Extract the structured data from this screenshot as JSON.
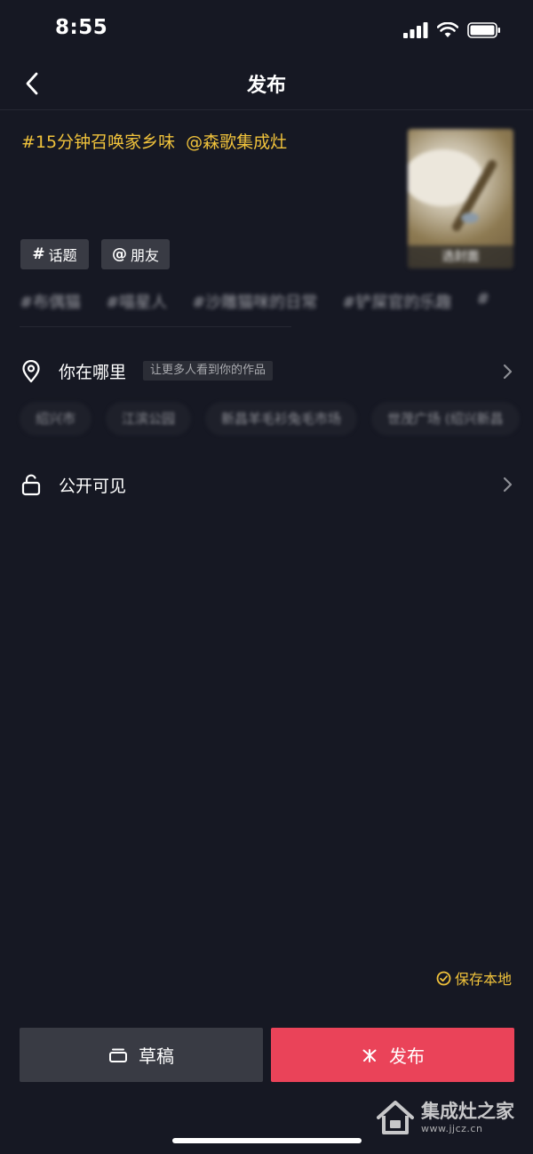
{
  "status_bar": {
    "time": "8:55"
  },
  "header": {
    "title": "发布"
  },
  "caption": {
    "hashtag": "#15分钟召唤家乡味",
    "mention": "@森歌集成灶"
  },
  "cover": {
    "label": "选封面"
  },
  "tag_buttons": {
    "topic": {
      "symbol": "#",
      "label": "话题"
    },
    "friend": {
      "symbol": "@",
      "label": "朋友"
    }
  },
  "suggested_hashtags": [
    "#布偶猫",
    "#喵星人",
    "#沙雕猫咪的日常",
    "#铲屎官的乐趣",
    "#"
  ],
  "location": {
    "label": "你在哪里",
    "hint": "让更多人看到你的作品",
    "suggestions": [
      "绍兴市",
      "江滨公园",
      "新昌羊毛衫兔毛市场",
      "世茂广场 (绍兴新昌"
    ]
  },
  "visibility": {
    "label": "公开可见"
  },
  "save_local": {
    "label": "保存本地"
  },
  "actions": {
    "draft_label": "草稿",
    "publish_label": "发布"
  },
  "watermark": {
    "title": "集成灶之家",
    "url": "www.jjcz.cn"
  },
  "colors": {
    "background": "#161823",
    "accent_yellow": "#f0c23b",
    "publish_red": "#ea4359",
    "button_gray": "#393b44"
  }
}
